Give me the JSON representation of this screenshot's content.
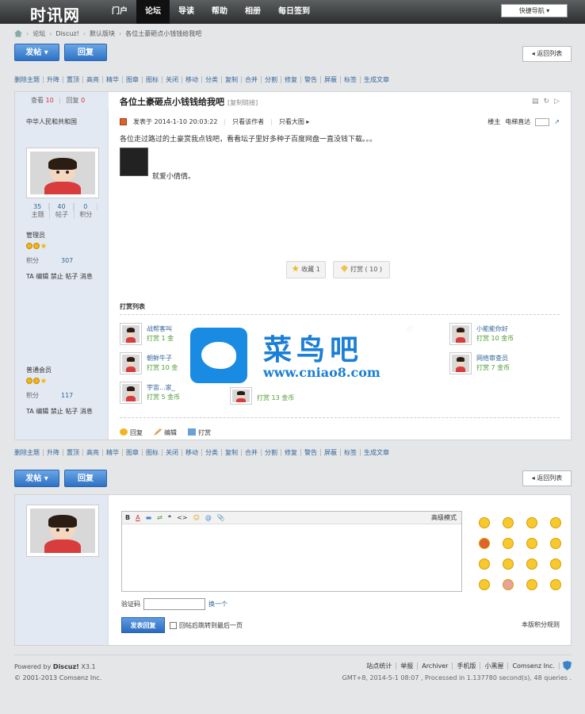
{
  "header": {
    "logo": "时讯网",
    "nav": [
      "门户",
      "论坛",
      "导读",
      "帮助",
      "相册",
      "每日签到"
    ],
    "active_nav": "论坛",
    "quick_nav": "快捷导航 ▾"
  },
  "breadcrumb": [
    "论坛",
    "Discuz!",
    "默认版块",
    "各位土豪砸点小钱钱给我吧"
  ],
  "toolbar": {
    "post_label": "发帖 ▾",
    "reply_label": "回复",
    "back_label": "◂ 返回列表"
  },
  "mod_bar": [
    "删除主题",
    "升降",
    "置顶",
    "高亮",
    "精华",
    "图章",
    "图标",
    "关闭",
    "移动",
    "分类",
    "复制",
    "合并",
    "分割",
    "修复",
    "警告",
    "屏蔽",
    "标签",
    "生成文章"
  ],
  "thread": {
    "views_label": "查看",
    "views": "10",
    "replies_label": "回复",
    "replies": "0",
    "title": "各位土豪砸点小钱钱给我吧",
    "title_tag": "[复制链接]",
    "author": "中华人民和共和国",
    "stats": [
      {
        "num": "35",
        "label": "主题"
      },
      {
        "num": "40",
        "label": "帖子"
      },
      {
        "num": "0",
        "label": "积分"
      }
    ],
    "group": "管理员",
    "points_label": "积分",
    "points_value": "307",
    "side_actions": "TA 编辑 禁止 帖子 消息",
    "post_time": "发表于 2014-1-10 20:03:22",
    "only_author": "只看该作者",
    "only_big": "只看大图 ▸",
    "floor_label": "楼主",
    "jump_label": "电梯直达",
    "content": "各位走过路过的土豪赏我点钱吧，看看坛子里好多种子百度网盘一直没钱下载。。。",
    "signature": "就爱小倩倩。",
    "fav_label": "收藏 1",
    "rate_label": "打赏 ( 10 )",
    "rate_title": "打赏列表",
    "raters": [
      {
        "name": "战帮客叫",
        "amount": "打赏 1 金"
      },
      {
        "name": "朝鲜牛子",
        "amount": "打赏 10 金"
      },
      {
        "name": "宇宙...家_",
        "amount": "打赏 5 金币"
      },
      {
        "name": "",
        "amount": "打赏 13 金币"
      },
      {
        "name": "小能能你好",
        "amount": "打赏 10 金币"
      },
      {
        "name": "网络审查员",
        "amount": "打赏 7 金币"
      }
    ],
    "rate_extra": "很",
    "second_group": "普通会员",
    "second_points_label": "积分",
    "second_points_value": "117",
    "second_side_actions": "TA 编辑 禁止 帖子 消息",
    "bottom_actions": [
      "回复",
      "编辑",
      "打赏"
    ]
  },
  "watermark": {
    "text": "菜鸟吧",
    "url": "www.cniao8.com"
  },
  "editor": {
    "tools": [
      "B",
      "A",
      "▬",
      "⇄",
      "❝",
      "<>",
      "☺",
      "@",
      "📎"
    ],
    "advanced": "高级模式",
    "vcode_label": "验证码",
    "vcode_change": "换一个",
    "submit_label": "发表回复",
    "back_checkbox": "回帖后跳转到最后一页",
    "rules": "本版积分规则"
  },
  "footer": {
    "powered": "Powered by ",
    "brand": "Discuz!",
    "version": "X3.1",
    "copyright": "© 2001-2013 Comsenz Inc.",
    "links": [
      "站点统计",
      "举报",
      "Archiver",
      "手机版",
      "小黑屋",
      "Comsenz Inc."
    ],
    "meta": "GMT+8, 2014-5-1 08:07 , Processed in 1.137780 second(s), 48 queries ."
  },
  "colors": {
    "accent": "#2f72c4",
    "link": "#336699",
    "topbar": "#2b2d2e"
  }
}
